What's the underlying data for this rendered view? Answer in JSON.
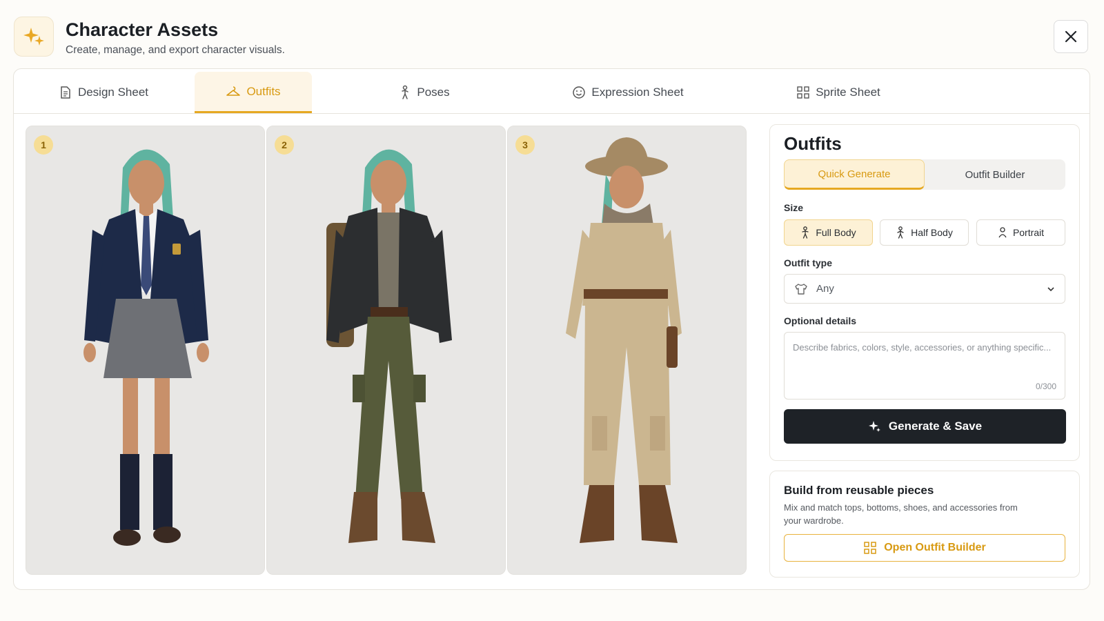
{
  "header": {
    "title": "Character Assets",
    "subtitle": "Create, manage, and export character visuals."
  },
  "tabs": [
    {
      "label": "Design Sheet",
      "icon": "document-icon"
    },
    {
      "label": "Outfits",
      "icon": "hanger-icon",
      "active": true
    },
    {
      "label": "Poses",
      "icon": "person-pose-icon"
    },
    {
      "label": "Expression Sheet",
      "icon": "smiley-icon"
    },
    {
      "label": "Sprite Sheet",
      "icon": "grid-icon"
    }
  ],
  "gallery": [
    {
      "number": "1",
      "outfit": "school-uniform"
    },
    {
      "number": "2",
      "outfit": "jacket-cargo"
    },
    {
      "number": "3",
      "outfit": "safari-jumpsuit"
    }
  ],
  "sidebar": {
    "title": "Outfits",
    "mode_tabs": [
      {
        "label": "Quick Generate",
        "active": true
      },
      {
        "label": "Outfit Builder",
        "active": false
      }
    ],
    "size_label": "Size",
    "sizes": [
      {
        "label": "Full Body",
        "active": true
      },
      {
        "label": "Half Body",
        "active": false
      },
      {
        "label": "Portrait",
        "active": false
      }
    ],
    "outfit_type_label": "Outfit type",
    "outfit_type_value": "Any",
    "details_label": "Optional details",
    "details_placeholder": "Describe fabrics, colors, style, accessories, or anything specific...",
    "details_counter": "0/300",
    "generate_button": "Generate & Save"
  },
  "builder": {
    "title": "Build from reusable pieces",
    "description": "Mix and match tops, bottoms, shoes, and accessories from your wardrobe.",
    "button": "Open Outfit Builder"
  },
  "colors": {
    "accent": "#e6a821",
    "accent_text": "#d89a12",
    "primary_button": "#1e2227",
    "hair": "#5fb3a0"
  }
}
